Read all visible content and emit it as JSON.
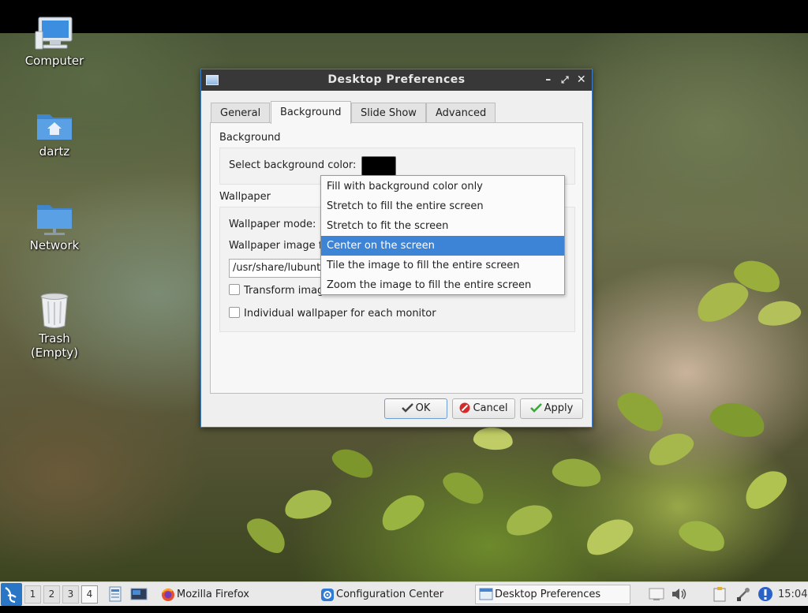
{
  "desktop_icons": [
    {
      "label": "Computer",
      "icon": "computer-icon"
    },
    {
      "label": "dartz",
      "icon": "home-folder-icon"
    },
    {
      "label": "Network",
      "icon": "network-folder-icon"
    },
    {
      "label": "Trash\n(Empty)",
      "label_line1": "Trash",
      "label_line2": "(Empty)",
      "icon": "trash-icon"
    }
  ],
  "window": {
    "title": "Desktop Preferences",
    "controls": {
      "minimize": "–",
      "maximize": "⤢",
      "close": "✕"
    },
    "tabs": [
      {
        "label": "General",
        "active": false
      },
      {
        "label": "Background",
        "active": true
      },
      {
        "label": "Slide Show",
        "active": false
      },
      {
        "label": "Advanced",
        "active": false
      }
    ],
    "background_group": {
      "title": "Background",
      "color_label": "Select background color:",
      "color_value": "#000000"
    },
    "wallpaper_group": {
      "title": "Wallpaper",
      "mode_label": "Wallpaper mode:",
      "image_label": "Wallpaper image f",
      "image_path": "/usr/share/lubuntu",
      "transform_label": "Transform imag",
      "individual_label": "Individual wallpaper for each monitor"
    },
    "mode_options": [
      "Fill with background color only",
      "Stretch to fill the entire screen",
      "Stretch to fit the screen",
      "Center on the screen",
      "Tile the image to fill the entire screen",
      "Zoom the image to fill the entire screen"
    ],
    "selected_mode": "Center on the screen",
    "buttons": {
      "ok": "OK",
      "cancel": "Cancel",
      "apply": "Apply"
    }
  },
  "taskbar": {
    "workspaces": [
      "1",
      "2",
      "3",
      "4"
    ],
    "active_workspace": "4",
    "tasks": [
      {
        "label": "Mozilla Firefox",
        "icon": "firefox-icon"
      },
      {
        "label": "Configuration Center",
        "icon": "settings-icon"
      },
      {
        "label": "Desktop Preferences",
        "icon": "window-icon",
        "active": true
      }
    ],
    "clock": "15:04"
  },
  "colors": {
    "accent": "#3d83d6",
    "titlebar": "#383838",
    "taskbar": "#e9e9e9"
  }
}
